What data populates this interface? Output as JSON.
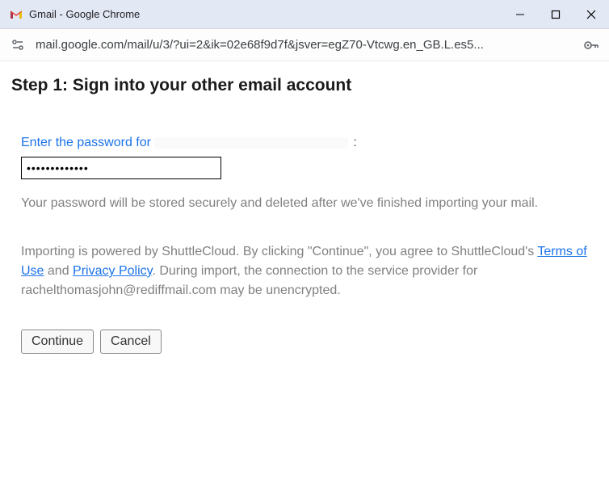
{
  "window": {
    "title": "Gmail - Google Chrome"
  },
  "addressbar": {
    "url": "mail.google.com/mail/u/3/?ui=2&ik=02e68f9d7f&jsver=egZ70-Vtcwg.en_GB.L.es5..."
  },
  "page": {
    "heading": "Step 1: Sign into your other email account",
    "password_label_prefix": "Enter the password for ",
    "password_label_suffix": ":",
    "password_value": "•••••••••••••",
    "storage_note": "Your password will be stored securely and deleted after we've finished importing your mail.",
    "disclosure": {
      "part1": "Importing is powered by ShuttleCloud. By clicking \"Continue\", you agree to ShuttleCloud's ",
      "terms_link": "Terms of Use",
      "part2": " and ",
      "privacy_link": "Privacy Policy",
      "part3": ". During import, the connection to the service provider for rachelthomasjohn@rediffmail.com may be unencrypted."
    },
    "buttons": {
      "continue": "Continue",
      "cancel": "Cancel"
    }
  }
}
